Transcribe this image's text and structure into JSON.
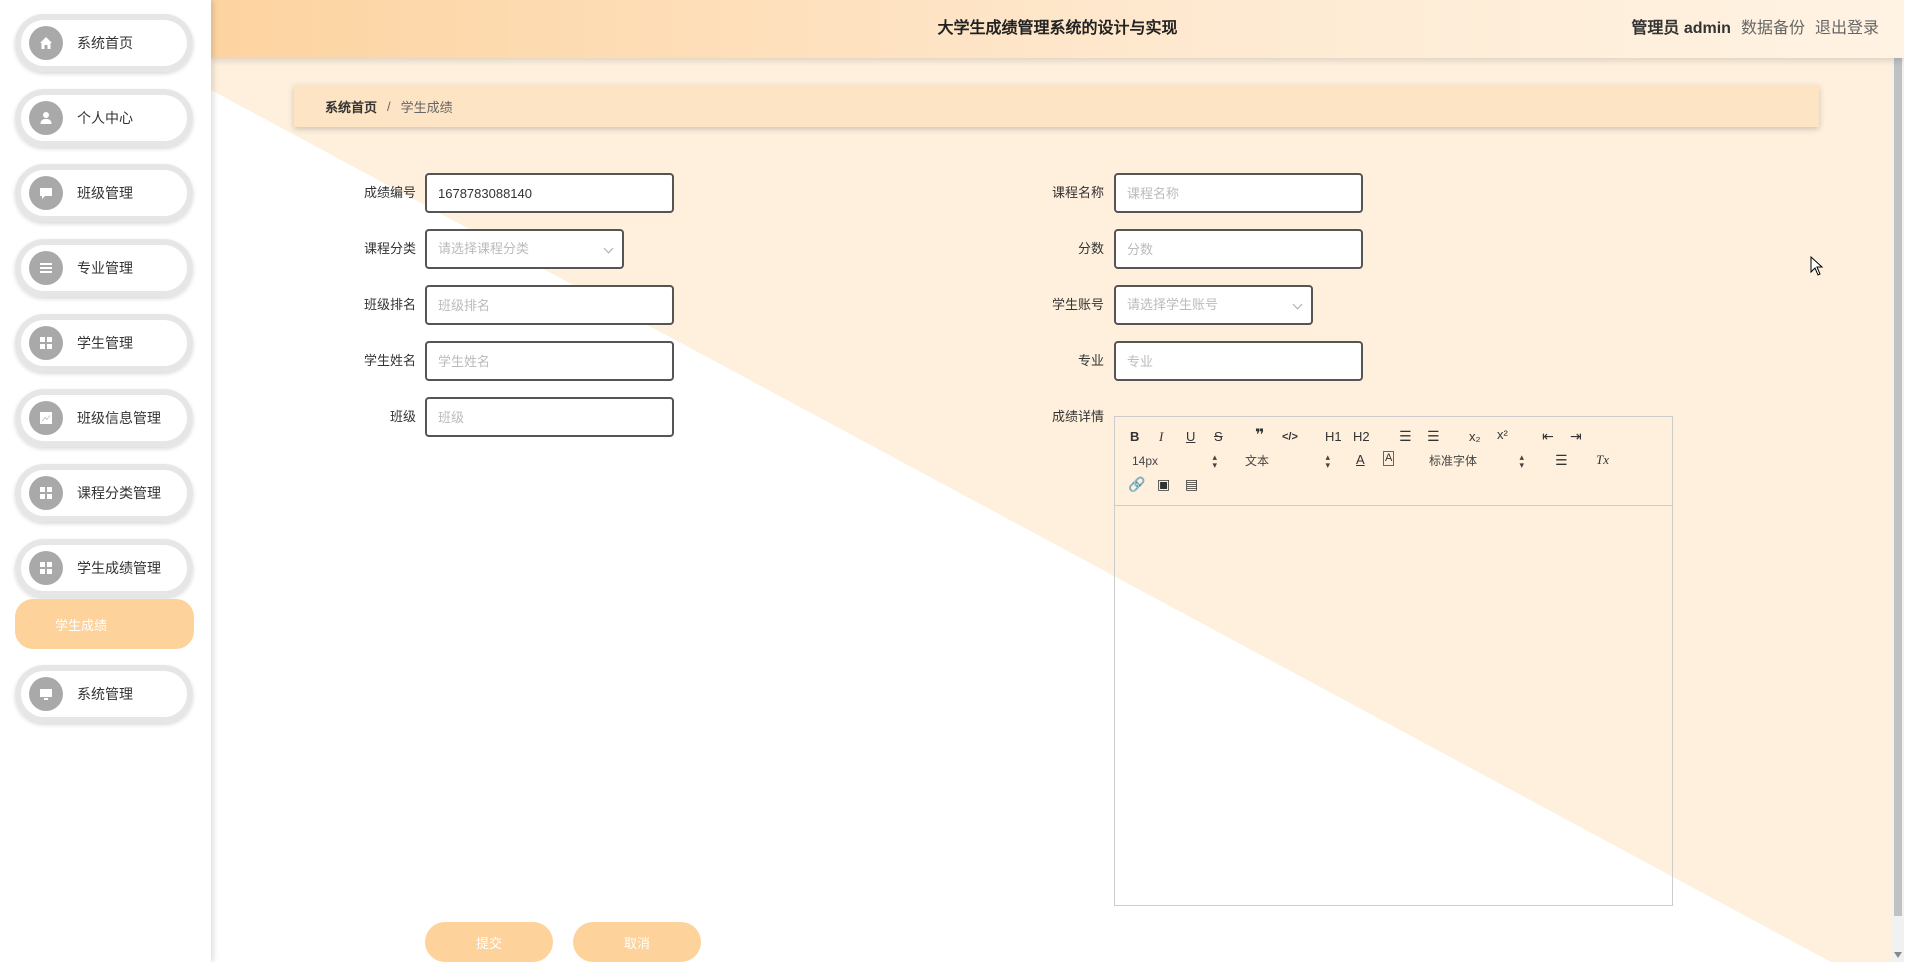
{
  "app": {
    "title": "大学生成绩管理系统的设计与实现"
  },
  "header": {
    "admin_label": "管理员 admin",
    "backup_label": "数据备份",
    "logout_label": "退出登录"
  },
  "sidebar": {
    "items": [
      {
        "label": "系统首页",
        "icon": "home-icon"
      },
      {
        "label": "个人中心",
        "icon": "user-icon"
      },
      {
        "label": "班级管理",
        "icon": "chat-icon"
      },
      {
        "label": "专业管理",
        "icon": "list-icon"
      },
      {
        "label": "学生管理",
        "icon": "grid-icon"
      },
      {
        "label": "班级信息管理",
        "icon": "chart-icon"
      },
      {
        "label": "课程分类管理",
        "icon": "grid-icon"
      },
      {
        "label": "学生成绩管理",
        "icon": "grid-icon"
      },
      {
        "label": "系统管理",
        "icon": "monitor-icon"
      }
    ],
    "active_sub": "学生成绩"
  },
  "breadcrumb": {
    "home": "系统首页",
    "separator": "/",
    "current": "学生成绩"
  },
  "form": {
    "score_id": {
      "label": "成绩编号",
      "value": "1678783088140"
    },
    "course_name": {
      "label": "课程名称",
      "placeholder": "课程名称"
    },
    "course_category": {
      "label": "课程分类",
      "placeholder": "请选择课程分类"
    },
    "score": {
      "label": "分数",
      "placeholder": "分数"
    },
    "class_rank": {
      "label": "班级排名",
      "placeholder": "班级排名"
    },
    "student_account": {
      "label": "学生账号",
      "placeholder": "请选择学生账号"
    },
    "student_name": {
      "label": "学生姓名",
      "placeholder": "学生姓名"
    },
    "major": {
      "label": "专业",
      "placeholder": "专业"
    },
    "class": {
      "label": "班级",
      "placeholder": "班级"
    },
    "details": {
      "label": "成绩详情"
    }
  },
  "editor": {
    "font_size": "14px",
    "paragraph": "文本",
    "font_family": "标准字体",
    "buttons": {
      "bold": "B",
      "italic": "I",
      "underline": "U",
      "strike": "S",
      "h1": "H1",
      "h2": "H2",
      "sub": "x₂",
      "sup": "x²",
      "color": "A",
      "bg": "A",
      "clean": "Tx"
    }
  },
  "actions": {
    "submit": "提交",
    "cancel": "取消"
  },
  "colors": {
    "accent": "#fdd29b",
    "header_start": "#fdd3a0",
    "bg_triangle": "#fef0dd"
  }
}
